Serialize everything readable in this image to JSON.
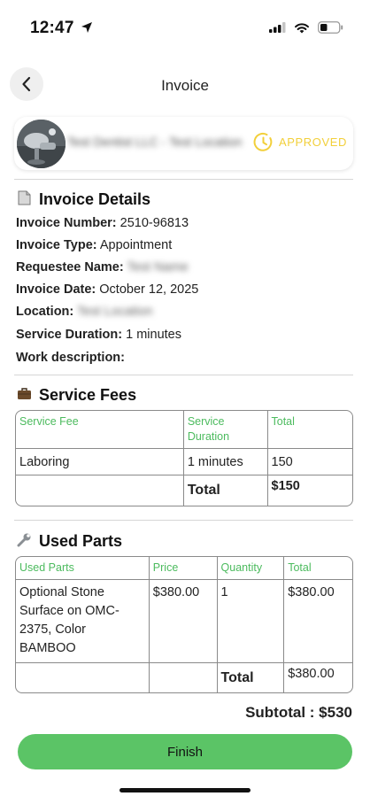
{
  "status_bar": {
    "time": "12:47"
  },
  "header": {
    "title": "Invoice"
  },
  "vendor": {
    "name": "Test Dentist LLC - Test Location",
    "status": "APPROVED",
    "status_color": "#f2cf3a"
  },
  "details": {
    "title": "Invoice Details",
    "invoice_number_label": "Invoice Number:",
    "invoice_number": "2510-96813",
    "invoice_type_label": "Invoice Type:",
    "invoice_type": "Appointment",
    "requestee_label": "Requestee Name:",
    "requestee": "Test Name",
    "date_label": "Invoice Date:",
    "date": "October 12, 2025",
    "location_label": "Location:",
    "location": "Test Location",
    "duration_label": "Service Duration:",
    "duration": "1 minutes",
    "work_label": "Work description:"
  },
  "service_fees": {
    "title": "Service Fees",
    "headers": {
      "fee": "Service Fee",
      "duration": "Service Duration",
      "total": "Total"
    },
    "rows": [
      {
        "fee": "Laboring",
        "duration": "1 minutes",
        "total": "150"
      }
    ],
    "total_label": "Total",
    "total_value": "$150"
  },
  "used_parts": {
    "title": "Used Parts",
    "headers": {
      "part": "Used Parts",
      "price": "Price",
      "quantity": "Quantity",
      "total": "Total"
    },
    "rows": [
      {
        "part": "Optional Stone Surface on OMC-2375, Color BAMBOO",
        "price": "$380.00",
        "quantity": "1",
        "total": "$380.00"
      }
    ],
    "total_label": "Total",
    "total_value": "$380.00"
  },
  "subtotal": "Subtotal : $530",
  "finish_label": "Finish",
  "accent_color": "#5bc466",
  "header_color": "#4cbb5e"
}
